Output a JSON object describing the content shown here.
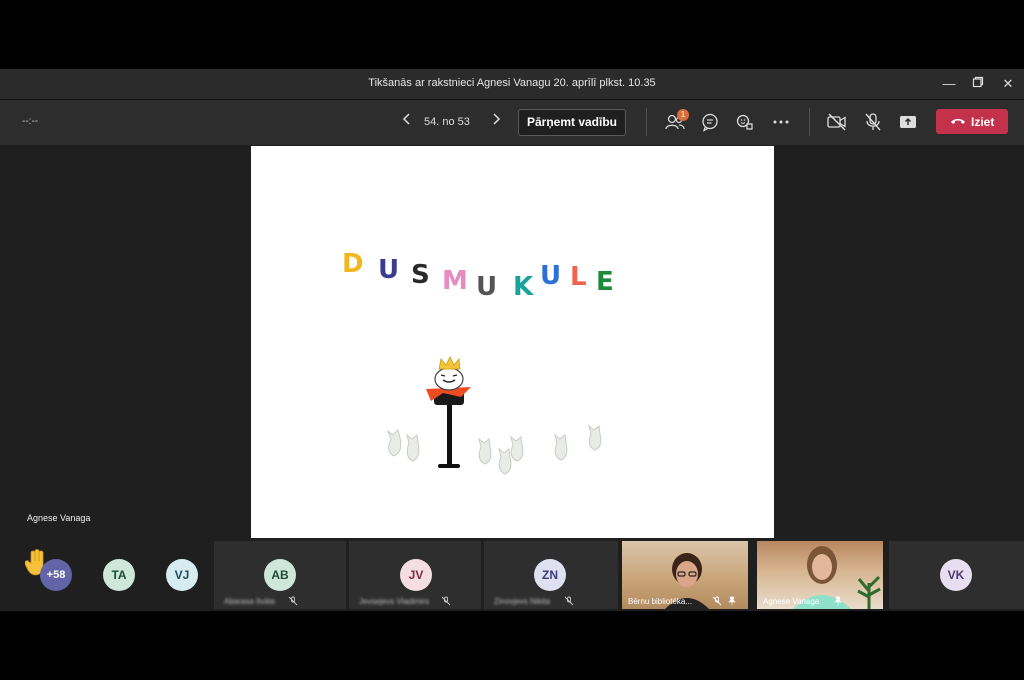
{
  "window": {
    "title": "Tikšanās ar rakstnieci Agnesi Vanagu 20. aprīlī plkst. 10.35",
    "controls": [
      "minimize-icon",
      "maximize-icon",
      "close-icon"
    ]
  },
  "toolbar": {
    "timer": "--:--",
    "page_indicator": "54. no 53",
    "take_control_label": "Pārņemt vadību",
    "participants_badge": "1",
    "leave_label": "Iziet",
    "icons": [
      "participants-icon",
      "chat-icon",
      "reactions-icon",
      "more-options-icon",
      "camera-off-icon",
      "mic-off-icon",
      "share-icon"
    ],
    "leave_color": "#c4314b"
  },
  "slide": {
    "title_letters": [
      {
        "char": "D",
        "color": "#f2b71f"
      },
      {
        "char": "U",
        "color": "#3b3b8f"
      },
      {
        "char": "S",
        "color": "#2a2a2a"
      },
      {
        "char": "M",
        "color": "#e58cc0"
      },
      {
        "char": "U",
        "color": "#555555"
      },
      {
        "char": "K",
        "color": "#1aa39a"
      },
      {
        "char": "U",
        "color": "#2c6fd6"
      },
      {
        "char": "L",
        "color": "#f0624d"
      },
      {
        "char": "E",
        "color": "#1f8a3a"
      }
    ]
  },
  "stage": {
    "presenter_name": "Agnese Vanaga"
  },
  "participants": {
    "raised_hand_count": "+58",
    "avatars": [
      {
        "initials": "TA"
      },
      {
        "initials": "VJ"
      }
    ],
    "tiles": [
      {
        "initials": "AB",
        "name": "Abarasa Ilvāte"
      },
      {
        "initials": "JV",
        "name": "Jevsejevs Vladimirs"
      },
      {
        "initials": "ZN",
        "name": "Zinovjevs Nikita"
      }
    ],
    "videos": [
      {
        "name": "Bērnu bibliotēka..."
      },
      {
        "name": "Agnese Vanaga"
      }
    ],
    "last_tile": {
      "initials": "VK"
    }
  }
}
